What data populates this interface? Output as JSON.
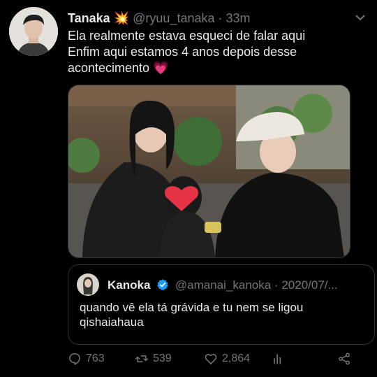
{
  "tweet": {
    "author_name": "Tanaka",
    "author_emoji": "💥",
    "author_handle": "@ryuu_tanaka",
    "separator": "·",
    "time": "33m",
    "lines": [
      "Ela realmente estava esqueci de falar aqui",
      "Enfim aqui estamos 4 anos depois desse",
      "acontecimento"
    ],
    "line_emoji": "💗"
  },
  "quote": {
    "author_name": "Kanoka",
    "author_handle": "@amanai_kanoka",
    "separator": "·",
    "date": "2020/07/...",
    "lines": [
      "quando vê ela tá grávida e tu nem se ligou",
      "qishaiahaua"
    ]
  },
  "actions": {
    "replies": "763",
    "retweets": "539",
    "likes": "2,864"
  },
  "icons": {
    "more": "more-dots-icon",
    "reply": "reply-icon",
    "retweet": "retweet-icon",
    "like": "heart-icon",
    "analytics": "analytics-icon",
    "share": "share-icon",
    "verified": "verified-badge-icon",
    "media_sticker": "heart-sticker-icon"
  },
  "colors": {
    "background": "#000000",
    "text": "#e7e9ea",
    "muted": "#71767b",
    "border": "#2f3336",
    "verified": "#1d9bf0"
  }
}
